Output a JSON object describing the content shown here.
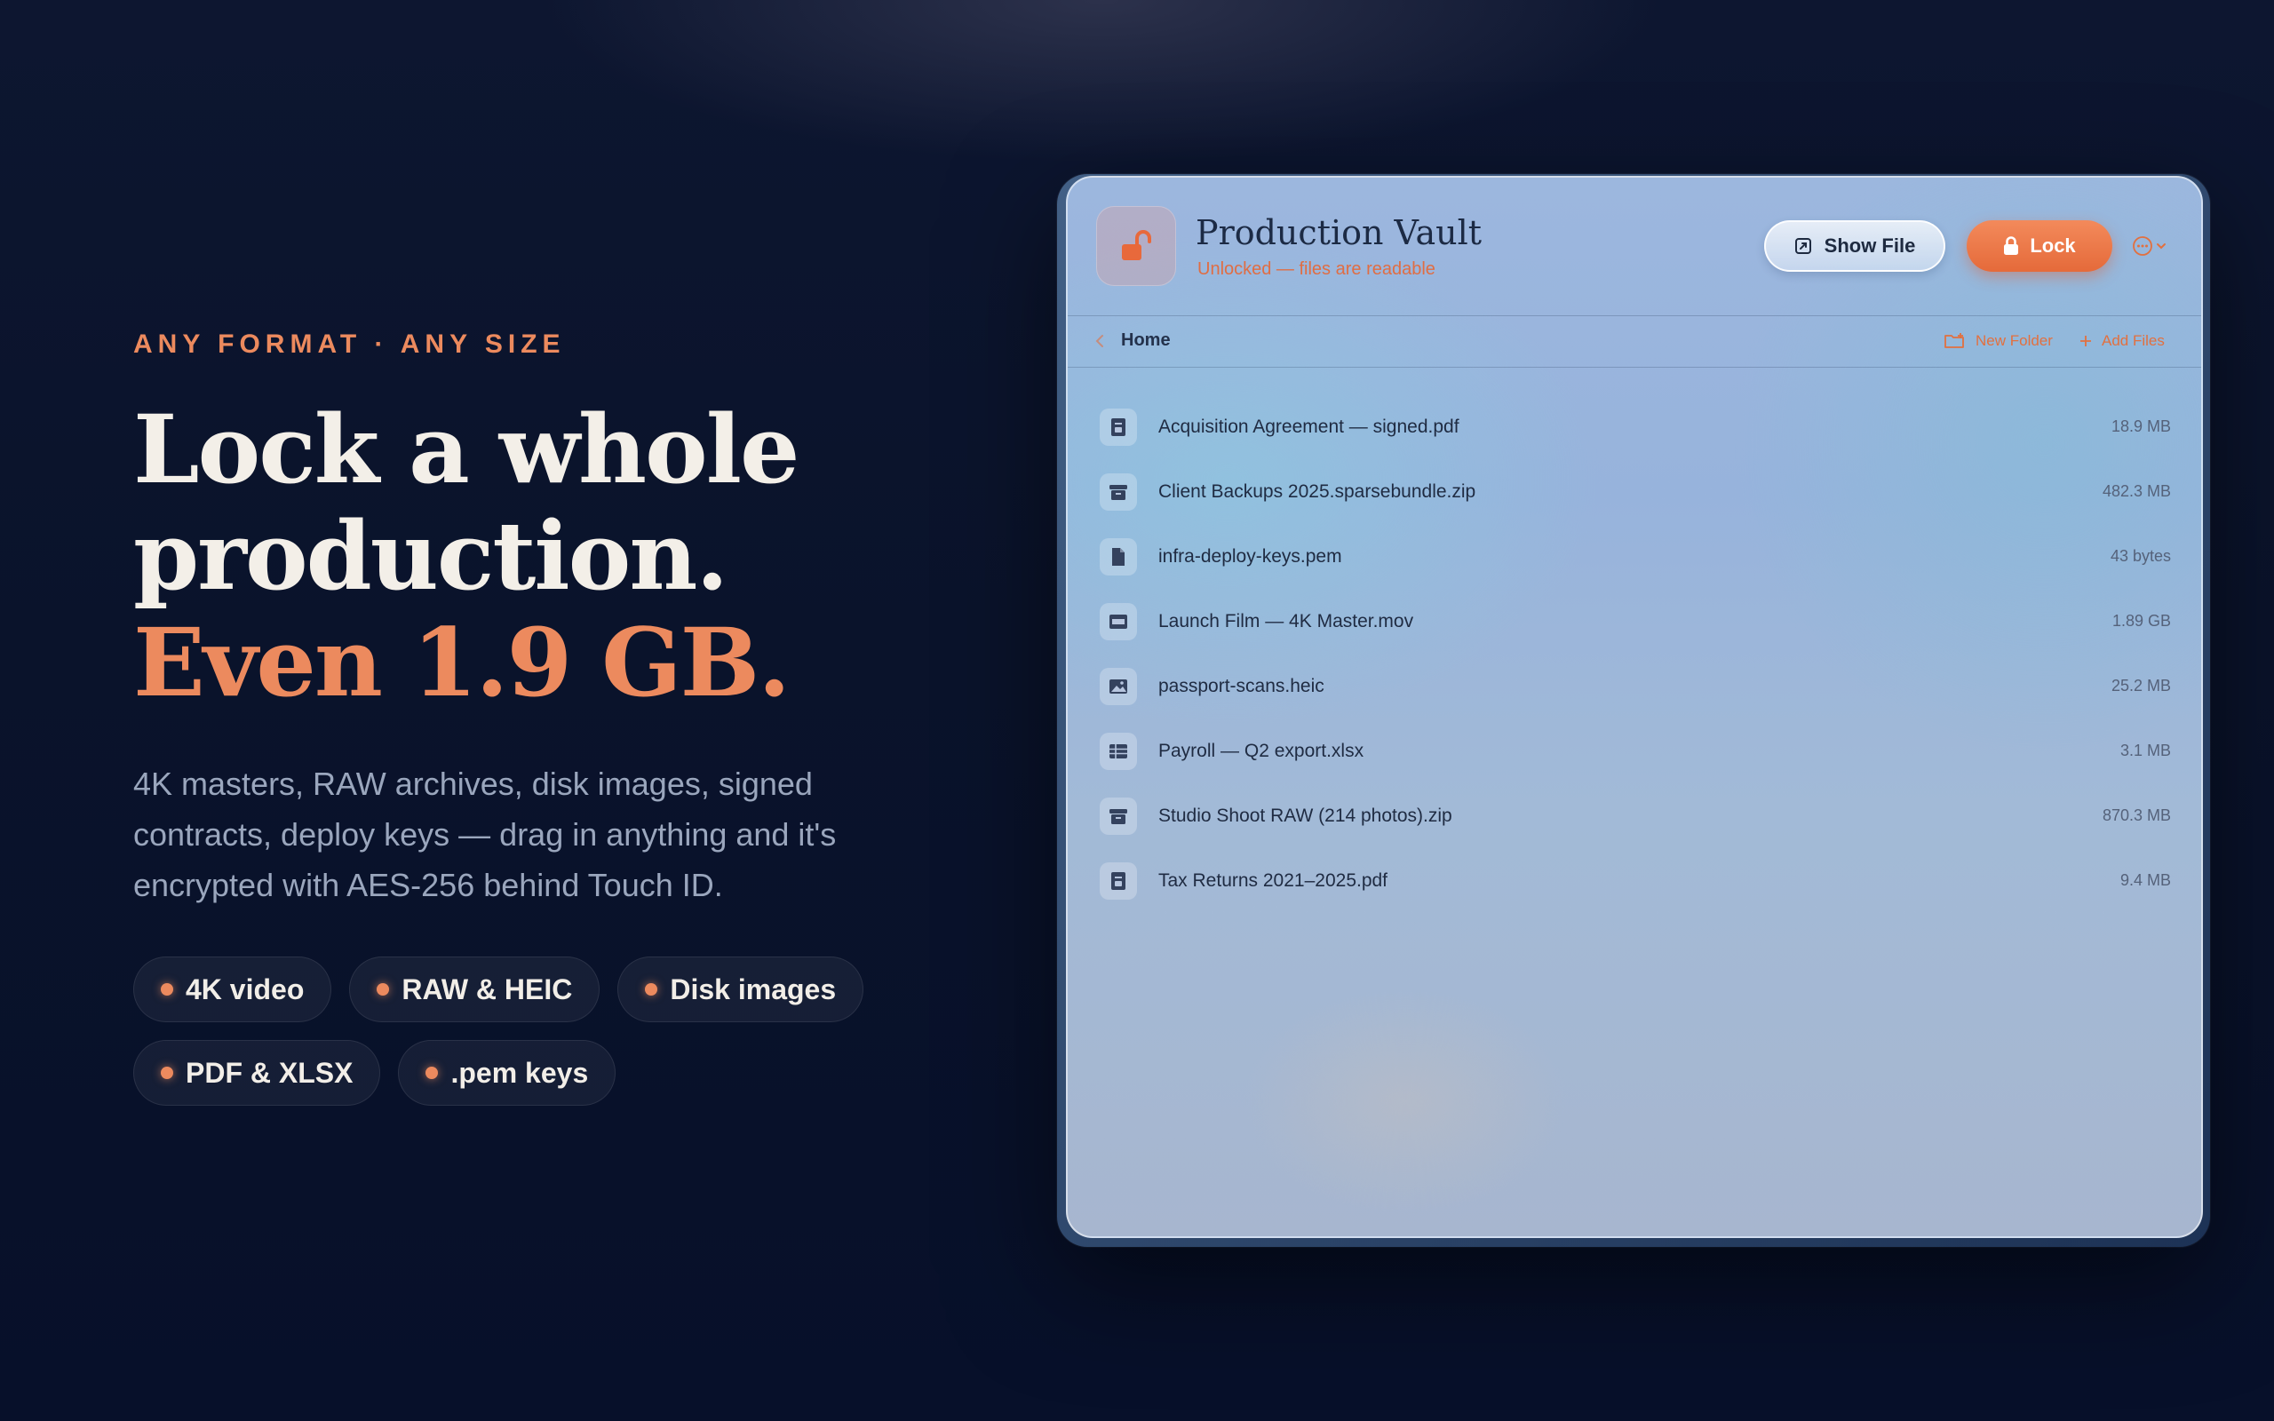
{
  "hero": {
    "eyebrow": "ANY FORMAT · ANY SIZE",
    "headline_line1": "Lock a whole",
    "headline_line2": "production.",
    "headline_accent": "Even 1.9 GB.",
    "subtitle": "4K masters, RAW archives, disk images, signed contracts, deploy keys — drag in anything and it's encrypted with AES-256 behind Touch ID.",
    "tags": [
      "4K video",
      "RAW & HEIC",
      "Disk images",
      "PDF & XLSX",
      ".pem keys"
    ]
  },
  "window": {
    "title": "Production Vault",
    "status": "Unlocked — files are readable",
    "show_file_label": "Show File",
    "lock_label": "Lock",
    "breadcrumb": "Home",
    "new_folder_label": "New Folder",
    "add_files_label": "Add Files",
    "files": [
      {
        "name": "Acquisition Agreement — signed.pdf",
        "size": "18.9 MB",
        "icon": "pdf-icon"
      },
      {
        "name": "Client Backups 2025.sparsebundle.zip",
        "size": "482.3 MB",
        "icon": "archive-icon"
      },
      {
        "name": "infra-deploy-keys.pem",
        "size": "43 bytes",
        "icon": "document-icon"
      },
      {
        "name": "Launch Film — 4K Master.mov",
        "size": "1.89 GB",
        "icon": "video-icon"
      },
      {
        "name": "passport-scans.heic",
        "size": "25.2 MB",
        "icon": "image-icon"
      },
      {
        "name": "Payroll — Q2 export.xlsx",
        "size": "3.1 MB",
        "icon": "spreadsheet-icon"
      },
      {
        "name": "Studio Shoot RAW (214 photos).zip",
        "size": "870.3 MB",
        "icon": "archive-icon"
      },
      {
        "name": "Tax Returns 2021–2025.pdf",
        "size": "9.4 MB",
        "icon": "pdf-icon"
      }
    ]
  },
  "colors": {
    "accent": "#ec8a5e",
    "lock_button": "#e56a3a",
    "background": "#0a132b"
  }
}
